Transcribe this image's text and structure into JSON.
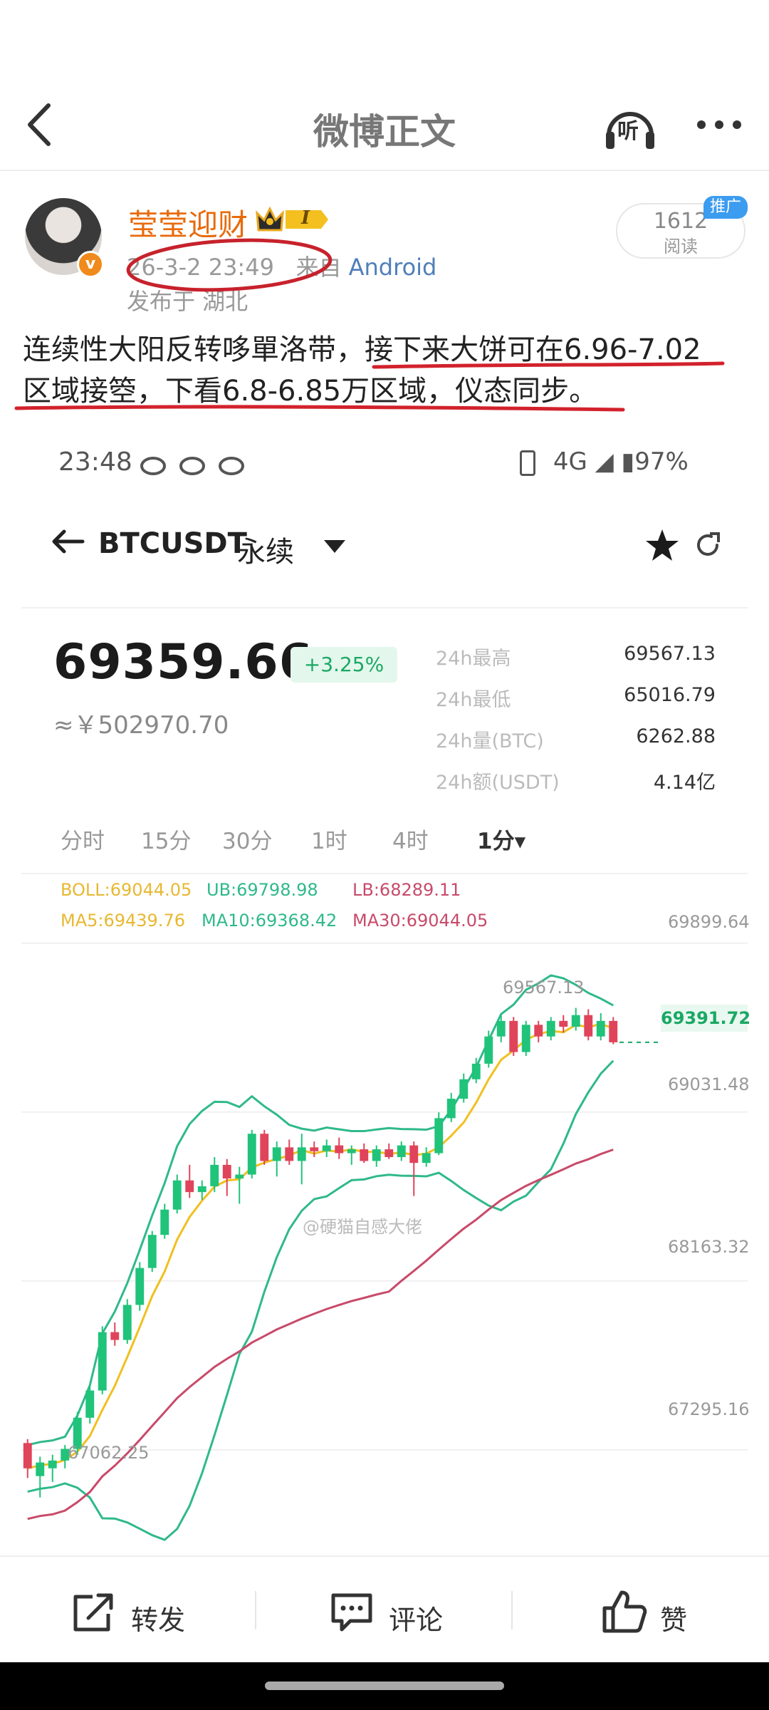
{
  "header": {
    "title": "微博正文",
    "listen_label": "听"
  },
  "post": {
    "username": "莹莹迎财",
    "vip_level": "I",
    "timestamp": "26-3-2 23:49",
    "source_prefix": "来自",
    "source": "Android",
    "location": "发布于 湖北",
    "avatar_badge": "v",
    "read_count": "1612",
    "read_label": "阅读",
    "promo_tag": "推广",
    "text_line1": "连续性大阳反转哆單洛带，接下来大饼可在6.96-7.02",
    "text_line2": "区域接箜，下看6.8-6.85万区域，仪态同步。"
  },
  "screenshot": {
    "status_time": "23:48",
    "status_right": "4G ◢ ▮97%",
    "pair": "BTCUSDT",
    "pair_type": "永续",
    "price": "69359.66",
    "change": "+3.25%",
    "cny": "≈￥502970.70",
    "stats": [
      {
        "label": "24h最高",
        "value": "69567.13"
      },
      {
        "label": "24h最低",
        "value": "65016.79"
      },
      {
        "label": "24h量(BTC)",
        "value": "6262.88"
      },
      {
        "label": "24h额(USDT)",
        "value": "4.14亿"
      }
    ],
    "timeframes": [
      "分时",
      "15分",
      "30分",
      "1时",
      "4时",
      "1分▾"
    ],
    "indicators": {
      "boll": "BOLL:69044.05",
      "ub": "UB:69798.98",
      "lb": "LB:68289.11",
      "ma5": "MA5:69439.76",
      "ma10": "MA10:69368.42",
      "ma30": "MA30:69044.05"
    },
    "watermark": "@硬猫自感大佬"
  },
  "chart_data": {
    "type": "candlestick",
    "y_ticks": [
      "69899.64",
      "69031.48",
      "68163.32",
      "67295.16"
    ],
    "current_price_label": "69391.72",
    "high_label": "69567.13",
    "low_label": "67062.25",
    "ylim": [
      66800,
      69950
    ],
    "candles": [
      [
        67330,
        67200,
        67350,
        67150
      ],
      [
        67160,
        67230,
        67260,
        67050
      ],
      [
        67200,
        67240,
        67270,
        67130
      ],
      [
        67240,
        67300,
        67320,
        67200
      ],
      [
        67300,
        67460,
        67490,
        67270
      ],
      [
        67460,
        67600,
        67630,
        67430
      ],
      [
        67600,
        67900,
        67930,
        67580
      ],
      [
        67900,
        67860,
        67950,
        67830
      ],
      [
        67860,
        68040,
        68070,
        67840
      ],
      [
        68040,
        68230,
        68260,
        68010
      ],
      [
        68230,
        68400,
        68420,
        68210
      ],
      [
        68400,
        68530,
        68560,
        68380
      ],
      [
        68530,
        68680,
        68710,
        68510
      ],
      [
        68680,
        68620,
        68760,
        68590
      ],
      [
        68620,
        68650,
        68680,
        68580
      ],
      [
        68650,
        68760,
        68800,
        68620
      ],
      [
        68760,
        68690,
        68790,
        68600
      ],
      [
        68690,
        68710,
        68750,
        68560
      ],
      [
        68710,
        68920,
        68940,
        68690
      ],
      [
        68920,
        68780,
        68940,
        68760
      ],
      [
        68780,
        68850,
        68880,
        68700
      ],
      [
        68850,
        68780,
        68890,
        68760
      ],
      [
        68780,
        68850,
        68920,
        68660
      ],
      [
        68850,
        68830,
        68880,
        68800
      ],
      [
        68830,
        68860,
        68890,
        68800
      ],
      [
        68860,
        68820,
        68900,
        68790
      ],
      [
        68820,
        68840,
        68860,
        68760
      ],
      [
        68840,
        68780,
        68870,
        68770
      ],
      [
        68780,
        68840,
        68860,
        68750
      ],
      [
        68840,
        68800,
        68870,
        68790
      ],
      [
        68800,
        68860,
        68880,
        68780
      ],
      [
        68860,
        68770,
        68880,
        68600
      ],
      [
        68770,
        68820,
        68850,
        68750
      ],
      [
        68820,
        69000,
        69030,
        68810
      ],
      [
        69000,
        69100,
        69130,
        68980
      ],
      [
        69100,
        69200,
        69230,
        69080
      ],
      [
        69200,
        69280,
        69310,
        69180
      ],
      [
        69280,
        69420,
        69450,
        69260
      ],
      [
        69420,
        69500,
        69530,
        69390
      ],
      [
        69500,
        69340,
        69520,
        69320
      ],
      [
        69340,
        69480,
        69500,
        69320
      ],
      [
        69480,
        69420,
        69500,
        69390
      ],
      [
        69420,
        69500,
        69520,
        69400
      ],
      [
        69500,
        69470,
        69530,
        69440
      ],
      [
        69470,
        69530,
        69567,
        69450
      ],
      [
        69530,
        69420,
        69560,
        69400
      ],
      [
        69420,
        69500,
        69540,
        69400
      ],
      [
        69500,
        69390,
        69520,
        69380
      ]
    ],
    "colors": {
      "up": "#20c37a",
      "down": "#e0445a",
      "boll_mid": "#f0c020",
      "boll_band": "#2fb98a",
      "ma30": "#c84a6a"
    }
  }
}
